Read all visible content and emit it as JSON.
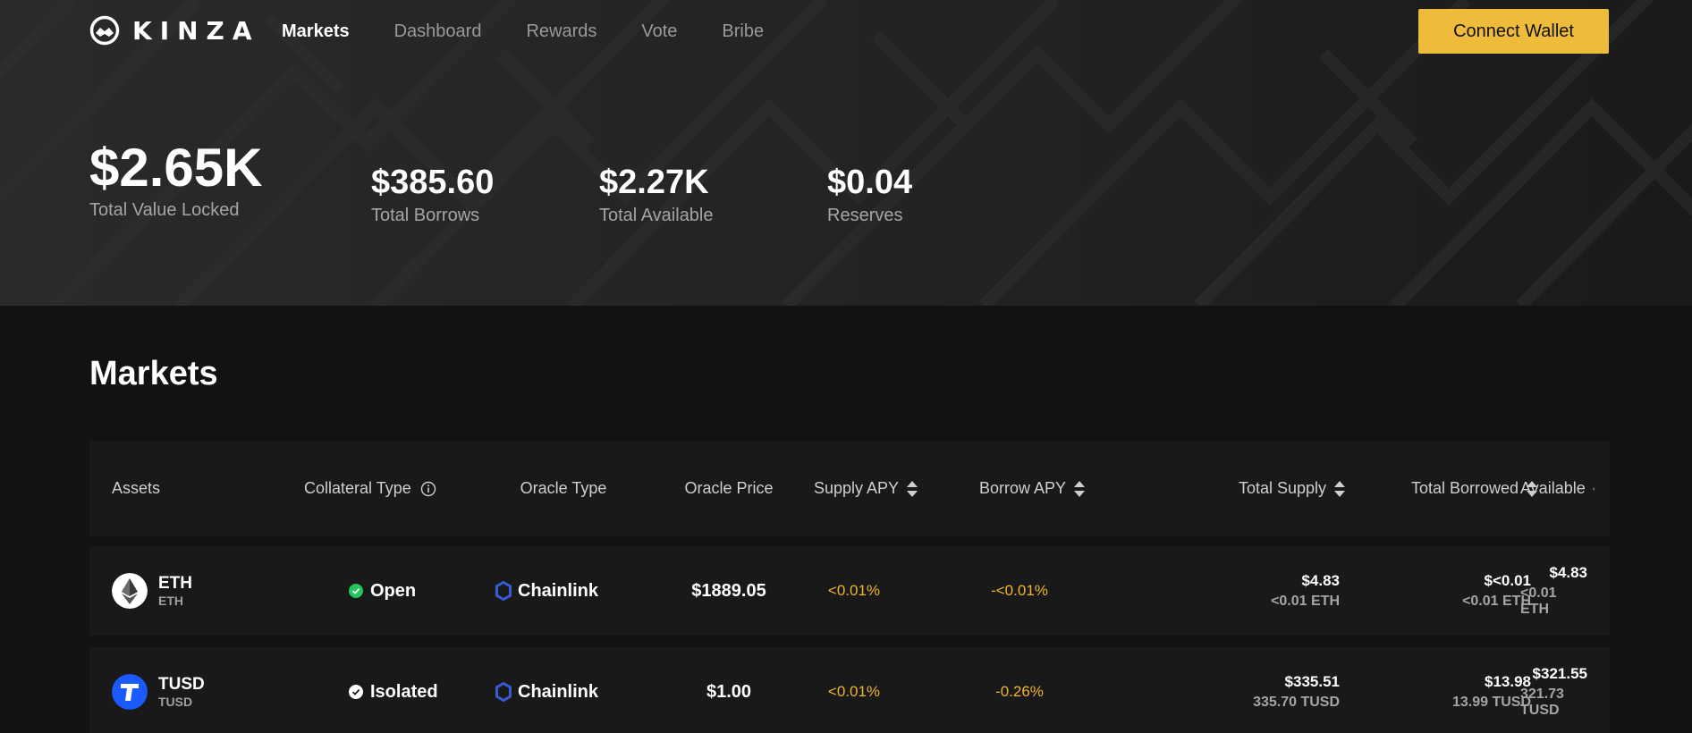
{
  "brand": {
    "name": "KINZA"
  },
  "nav": {
    "links": [
      "Markets",
      "Dashboard",
      "Rewards",
      "Vote",
      "Bribe"
    ],
    "active": "Markets",
    "connect_label": "Connect Wallet"
  },
  "stats": [
    {
      "value": "$2.65K",
      "label": "Total Value Locked"
    },
    {
      "value": "$385.60",
      "label": "Total Borrows"
    },
    {
      "value": "$2.27K",
      "label": "Total Available"
    },
    {
      "value": "$0.04",
      "label": "Reserves"
    }
  ],
  "section_title": "Markets",
  "table": {
    "headers": {
      "assets": "Assets",
      "collateral_type": "Collateral Type",
      "oracle_type": "Oracle Type",
      "oracle_price": "Oracle Price",
      "supply_apy": "Supply APY",
      "borrow_apy": "Borrow APY",
      "total_supply": "Total Supply",
      "total_borrowed": "Total Borrowed",
      "available": "Available"
    },
    "rows": [
      {
        "symbol": "ETH",
        "sub": "ETH",
        "collateral": "Open",
        "oracle": "Chainlink",
        "price": "$1889.05",
        "supply_apy": "<0.01%",
        "borrow_apy": "-<0.01%",
        "total_supply": "$4.83",
        "total_supply_sub": "<0.01 ETH",
        "total_borrowed": "$<0.01",
        "total_borrowed_sub": "<0.01 ETH",
        "available": "$4.83",
        "available_sub": "<0.01 ETH"
      },
      {
        "symbol": "TUSD",
        "sub": "TUSD",
        "collateral": "Isolated",
        "oracle": "Chainlink",
        "price": "$1.00",
        "supply_apy": "<0.01%",
        "borrow_apy": "-0.26%",
        "total_supply": "$335.51",
        "total_supply_sub": "335.70 TUSD",
        "total_borrowed": "$13.98",
        "total_borrowed_sub": "13.99 TUSD",
        "available": "$321.55",
        "available_sub": "321.73 TUSD"
      }
    ]
  },
  "colors": {
    "accent": "#eebc3a",
    "apy": "#f0b429",
    "open": "#22c55e",
    "chainlink": "#375bd2",
    "tusd": "#1a5aff"
  },
  "icons": [
    "kinza-logo-icon",
    "info-icon",
    "sort-icon",
    "check-circle-icon",
    "chainlink-icon",
    "eth-icon",
    "tusd-icon"
  ]
}
